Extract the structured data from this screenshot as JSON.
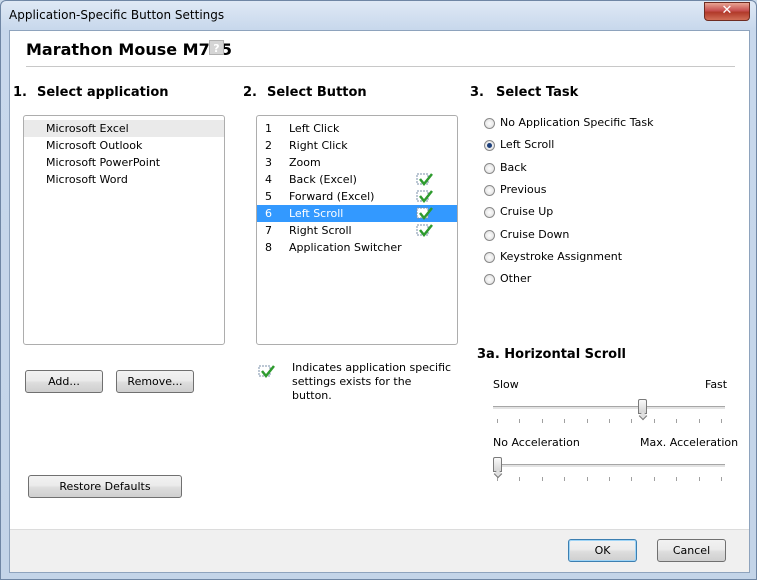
{
  "window": {
    "title": "Application-Specific Button Settings",
    "close_glyph": "✕"
  },
  "device": {
    "name": "Marathon Mouse M705",
    "help_glyph": "?"
  },
  "section1": {
    "number": "1.",
    "title": "Select application",
    "applications": [
      "Microsoft Excel",
      "Microsoft Outlook",
      "Microsoft PowerPoint",
      "Microsoft Word"
    ],
    "selected_index": 0,
    "add_label": "Add...",
    "remove_label": "Remove...",
    "restore_label": "Restore Defaults"
  },
  "section2": {
    "number": "2.",
    "title": "Select Button",
    "buttons": [
      {
        "num": "1",
        "label": "Left Click",
        "app_specific": false
      },
      {
        "num": "2",
        "label": "Right Click",
        "app_specific": false
      },
      {
        "num": "3",
        "label": "Zoom",
        "app_specific": false
      },
      {
        "num": "4",
        "label": "Back (Excel)",
        "app_specific": true
      },
      {
        "num": "5",
        "label": "Forward (Excel)",
        "app_specific": true
      },
      {
        "num": "6",
        "label": "Left Scroll",
        "app_specific": true
      },
      {
        "num": "7",
        "label": "Right Scroll",
        "app_specific": true
      },
      {
        "num": "8",
        "label": "Application Switcher",
        "app_specific": false
      }
    ],
    "selected_index": 5,
    "note": "Indicates application specific settings exists for the button."
  },
  "section3": {
    "number": "3.",
    "title": "Select Task",
    "tasks": [
      "No Application Specific Task",
      "Left Scroll",
      "Back",
      "Previous",
      "Cruise Up",
      "Cruise Down",
      "Keystroke Assignment",
      "Other"
    ],
    "selected_index": 1
  },
  "section3a": {
    "title": "3a. Horizontal Scroll",
    "speed": {
      "min_label": "Slow",
      "max_label": "Fast",
      "value": 0.65
    },
    "acceleration": {
      "min_label": "No Acceleration",
      "max_label": "Max. Acceleration",
      "value": 0.0
    }
  },
  "footer": {
    "ok_label": "OK",
    "cancel_label": "Cancel"
  },
  "colors": {
    "selection": "#3399ff",
    "check": "#2e9b2e"
  }
}
